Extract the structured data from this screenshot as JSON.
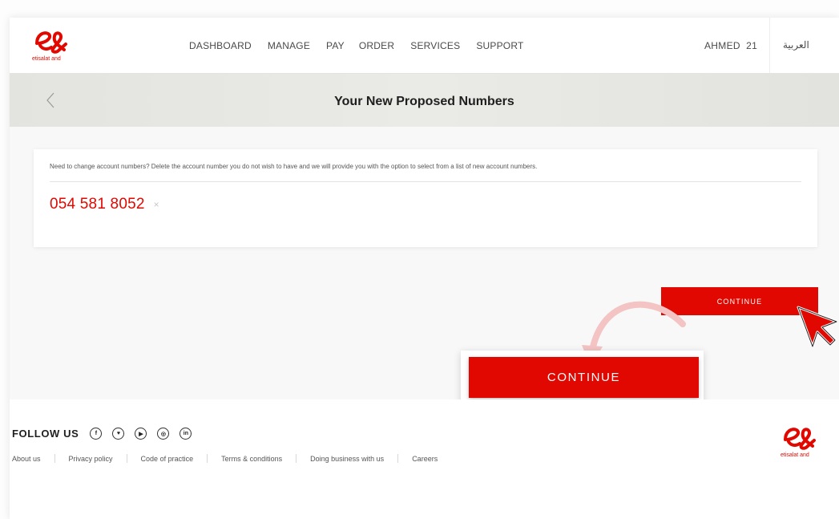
{
  "header": {
    "logo_text": "etisalat and",
    "nav": [
      "DASHBOARD",
      "MANAGE",
      "PAY",
      "ORDER",
      "SERVICES",
      "SUPPORT"
    ],
    "user_name": "AHMED  21",
    "language": "العربية"
  },
  "page": {
    "title": "Your New Proposed Numbers"
  },
  "card": {
    "note": "Need to change account numbers? Delete the account number you do not wish to have and we will provide you with the option to select from a list of new account numbers.",
    "number": "054 581 8052",
    "remove_glyph": "×"
  },
  "actions": {
    "continue_label": "CONTINUE",
    "continue_callout_label": "CONTINUE"
  },
  "footer": {
    "follow_label": "FOLLOW US",
    "social": [
      {
        "icon": "facebook-icon",
        "glyph": "f"
      },
      {
        "icon": "twitter-icon",
        "glyph": "♥"
      },
      {
        "icon": "youtube-icon",
        "glyph": "▶"
      },
      {
        "icon": "instagram-icon",
        "glyph": "◎"
      },
      {
        "icon": "linkedin-icon",
        "glyph": "in"
      }
    ],
    "links": [
      "About us",
      "Privacy policy",
      "Code of practice",
      "Terms & conditions",
      "Doing business with us",
      "Careers"
    ],
    "logo_text": "etisalat and"
  },
  "colors": {
    "brand_red": "#e00800",
    "title_bar": "#e6e6e2",
    "text": "#4a4a4a"
  }
}
